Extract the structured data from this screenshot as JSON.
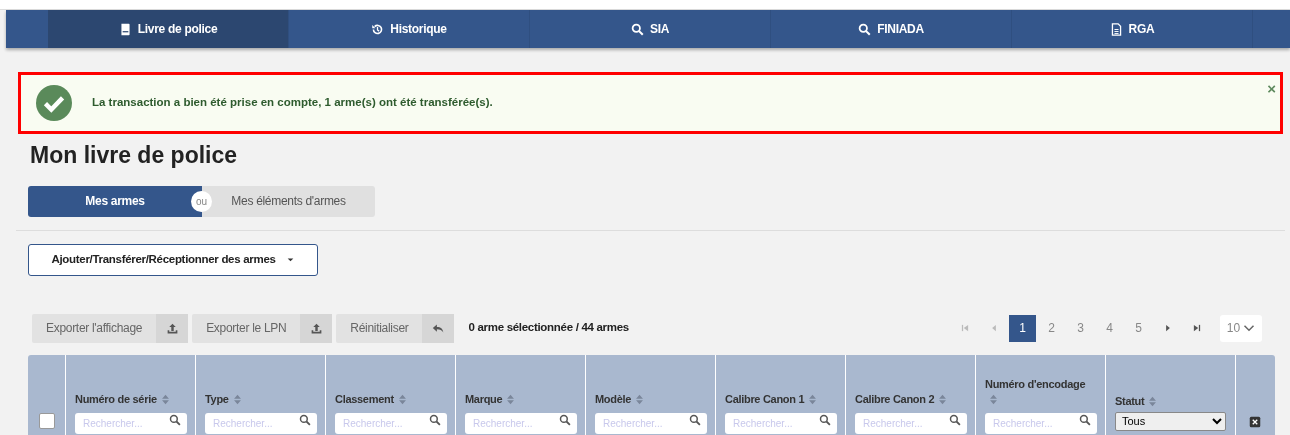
{
  "nav": [
    {
      "label": "Livre de police",
      "selected": true
    },
    {
      "label": "Historique",
      "selected": false
    },
    {
      "label": "SIA",
      "selected": false
    },
    {
      "label": "FINIADA",
      "selected": false
    },
    {
      "label": "RGA",
      "selected": false
    }
  ],
  "alert": {
    "message": "La transaction a bien été prise en compte, 1 arme(s) ont été transférée(s).",
    "close": "×"
  },
  "page_title": "Mon livre de police",
  "toggle": {
    "options": [
      {
        "label": "Mes armes",
        "selected": true
      },
      {
        "label": "Mes éléments d'armes",
        "selected": false
      }
    ],
    "separator": "ou"
  },
  "actions_dropdown": {
    "label": "Ajouter/Transférer/Réceptionner des armes"
  },
  "toolbar": [
    {
      "label": "Exporter l'affichage"
    },
    {
      "label": "Exporter le LPN"
    },
    {
      "label": "Réinitialiser"
    }
  ],
  "selection_summary": "0 arme sélectionnée / 44 armes",
  "pagination": {
    "pages": [
      {
        "label": "1",
        "selected": true
      },
      {
        "label": "2",
        "selected": false
      },
      {
        "label": "3",
        "selected": false
      },
      {
        "label": "4",
        "selected": false
      },
      {
        "label": "5",
        "selected": false
      }
    ],
    "first_disabled": true,
    "page_size": "10"
  },
  "table": {
    "select_all_checked": false,
    "columns": [
      {
        "label": "Numéro de série",
        "kind": "search",
        "placeholder": "Rechercher..."
      },
      {
        "label": "Type",
        "kind": "search",
        "placeholder": "Rechercher..."
      },
      {
        "label": "Classement",
        "kind": "search",
        "placeholder": "Rechercher..."
      },
      {
        "label": "Marque",
        "kind": "search",
        "placeholder": "Rechercher..."
      },
      {
        "label": "Modèle",
        "kind": "search",
        "placeholder": "Rechercher..."
      },
      {
        "label": "Calibre Canon 1",
        "kind": "search",
        "placeholder": "Rechercher..."
      },
      {
        "label": "Calibre Canon 2",
        "kind": "search",
        "placeholder": "Rechercher..."
      },
      {
        "label": "Numéro d'encodage",
        "kind": "search",
        "placeholder": "Rechercher..."
      },
      {
        "label": "Statut",
        "kind": "select",
        "value": "Tous"
      }
    ]
  }
}
